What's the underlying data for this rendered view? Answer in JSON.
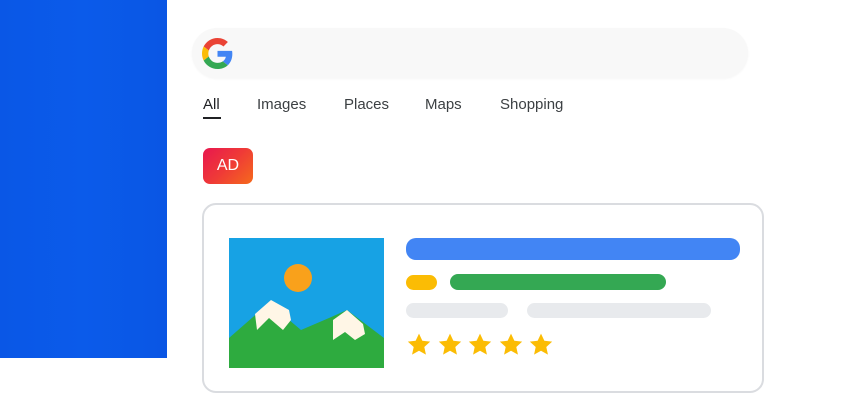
{
  "colors": {
    "left_panel": "#0a57e6",
    "title_bar": "#4285f4",
    "green_bar": "#34a853",
    "yellow_bar": "#fbbc04",
    "gray_bar": "#e8eaed",
    "star": "#fbbc04",
    "ad_gradient_start": "#e8174f",
    "ad_gradient_end": "#f56a1c"
  },
  "search": {
    "logo_icon": "google-g-icon",
    "value": ""
  },
  "tabs": [
    {
      "label": "All",
      "active": true
    },
    {
      "label": "Images",
      "active": false
    },
    {
      "label": "Places",
      "active": false
    },
    {
      "label": "Maps",
      "active": false
    },
    {
      "label": "Shopping",
      "active": false
    }
  ],
  "ad": {
    "badge_label": "AD"
  },
  "result_card": {
    "thumbnail_icon": "landscape-image-icon",
    "rating_stars": 5
  }
}
